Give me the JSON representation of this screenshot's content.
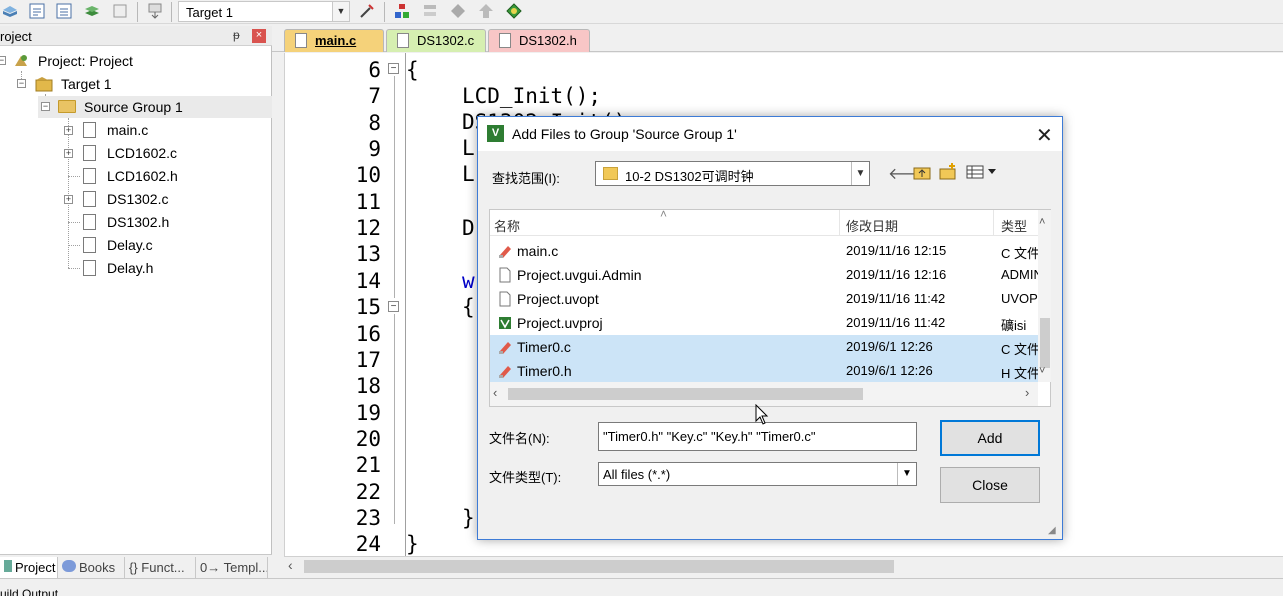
{
  "toolbar": {
    "target_value": "Target 1"
  },
  "project_panel": {
    "title": "roject",
    "pin_glyph": "ᵽ",
    "close_glyph": "×",
    "tree": {
      "root": "Project: Project",
      "target": "Target 1",
      "group": "Source Group 1",
      "files": [
        "main.c",
        "LCD1602.c",
        "LCD1602.h",
        "DS1302.c",
        "DS1302.h",
        "Delay.c",
        "Delay.h"
      ]
    },
    "bottom_tabs": [
      "Project",
      "Books",
      "{} Funct...",
      "0→ Templ..."
    ]
  },
  "editor": {
    "tabs": [
      {
        "label": "main.c",
        "color": "#f5d27a"
      },
      {
        "label": "DS1302.c",
        "color": "#d6efb1"
      },
      {
        "label": "DS1302.h",
        "color": "#f8c6c6"
      }
    ],
    "line_numbers": [
      "6",
      "7",
      "8",
      "9",
      "10",
      "11",
      "12",
      "13",
      "14",
      "15",
      "16",
      "17",
      "18",
      "19",
      "20",
      "21",
      "22",
      "23",
      "24"
    ],
    "code": {
      "l6": "{",
      "l7": "LCD_Init();",
      "l8": "DS1302_Init();",
      "l9": "L",
      "l10": "L",
      "l12": "D",
      "l14": "w",
      "l15": "{",
      "l23": "}",
      "l24": "}"
    }
  },
  "status": {
    "text": "uild Output"
  },
  "dialog": {
    "title": "Add Files to Group 'Source Group 1'",
    "lookin_label": "查找范围(I):",
    "lookin_value": "10-2 DS1302可调时钟",
    "columns": {
      "name": "名称",
      "date": "修改日期",
      "type": "类型"
    },
    "files": [
      {
        "name": "main.c",
        "date": "2019/11/16 12:15",
        "type": "C 文件",
        "selected": false,
        "icon": "c-source-icon"
      },
      {
        "name": "Project.uvgui.Admin",
        "date": "2019/11/16 12:16",
        "type": "ADMIN",
        "selected": false,
        "icon": "blank-file-icon"
      },
      {
        "name": "Project.uvopt",
        "date": "2019/11/16 11:42",
        "type": "UVOPT",
        "selected": false,
        "icon": "blank-file-icon"
      },
      {
        "name": "Project.uvproj",
        "date": "2019/11/16 11:42",
        "type": "礦isi",
        "selected": false,
        "icon": "keil-project-icon"
      },
      {
        "name": "Timer0.c",
        "date": "2019/6/1 12:26",
        "type": "C 文件",
        "selected": true,
        "icon": "c-source-icon"
      },
      {
        "name": "Timer0.h",
        "date": "2019/6/1 12:26",
        "type": "H 文件",
        "selected": true,
        "icon": "c-header-icon"
      }
    ],
    "filename_label": "文件名(N):",
    "filename_value": "\"Timer0.h\" \"Key.c\" \"Key.h\" \"Timer0.c\"",
    "filetype_label": "文件类型(T):",
    "filetype_value": "All files (*.*)",
    "add_label": "Add",
    "close_label": "Close"
  }
}
